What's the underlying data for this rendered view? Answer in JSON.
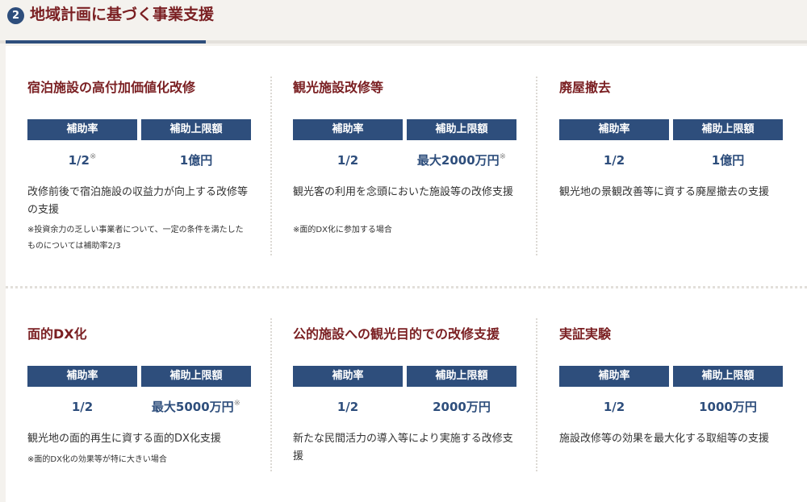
{
  "section": {
    "number": "2",
    "title": "地域計画に基づく事業支援"
  },
  "labels": {
    "rate": "補助率",
    "limit": "補助上限額"
  },
  "cards": [
    {
      "title": "宿泊施設の高付加価値化改修",
      "rate": "1/2",
      "rate_mark": "※",
      "limit": "1億円",
      "limit_mark": "",
      "desc": "改修前後で宿泊施設の収益力が向上する改修等の支援",
      "note": "※投資余力の乏しい事業者について、一定の条件を満たしたものについては補助率2/3"
    },
    {
      "title": "観光施設改修等",
      "rate": "1/2",
      "rate_mark": "",
      "limit": "最大2000万円",
      "limit_mark": "※",
      "desc": "観光客の利用を念頭においた施設等の改修支援",
      "note": "※面的DX化に参加する場合"
    },
    {
      "title": "廃屋撤去",
      "rate": "1/2",
      "rate_mark": "",
      "limit": "1億円",
      "limit_mark": "",
      "desc": "観光地の景観改善等に資する廃屋撤去の支援",
      "note": ""
    },
    {
      "title": "面的DX化",
      "rate": "1/2",
      "rate_mark": "",
      "limit": "最大5000万円",
      "limit_mark": "※",
      "desc": "観光地の面的再生に資する面的DX化支援",
      "note": "※面的DX化の効果等が特に大きい場合"
    },
    {
      "title": "公的施設への観光目的での改修支援",
      "rate": "1/2",
      "rate_mark": "",
      "limit": "2000万円",
      "limit_mark": "",
      "desc": "新たな民間活力の導入等により実施する改修支援",
      "note": ""
    },
    {
      "title": "実証実験",
      "rate": "1/2",
      "rate_mark": "",
      "limit": "1000万円",
      "limit_mark": "",
      "desc": "施設改修等の効果を最大化する取組等の支援",
      "note": ""
    }
  ]
}
